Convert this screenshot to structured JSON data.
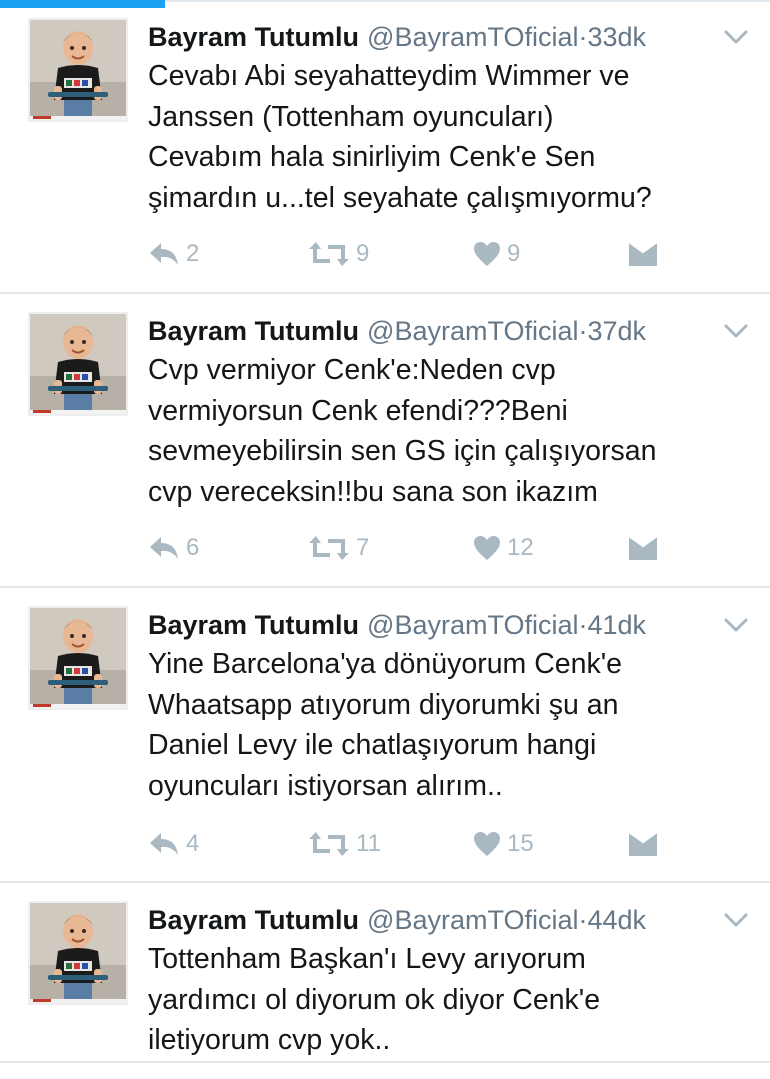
{
  "colors": {
    "accent": "#1da1f2",
    "muted_icon": "#aab8c2",
    "secondary_text": "#657786",
    "divider": "#e1e8ed"
  },
  "tweets": [
    {
      "name": "Bayram Tutumlu",
      "handle": "@BayramTOficial",
      "separator": "·",
      "time": "33dk",
      "lines": [
        "Cevabı Abi seyahatteydim Wimmer ve",
        "Janssen (Tottenham oyuncuları)",
        "Cevabım hala sinirliyim Cenk'e Sen",
        "şimardın u...tel seyahate çalışmıyormu?"
      ],
      "replies": "2",
      "retweets": "9",
      "likes": "9"
    },
    {
      "name": "Bayram Tutumlu",
      "handle": "@BayramTOficial",
      "separator": "·",
      "time": "37dk",
      "lines": [
        "Cvp vermiyor Cenk'e:Neden cvp",
        "vermiyorsun Cenk efendi???Beni",
        "sevmeyebilirsin sen GS için çalışıyorsan",
        "cvp vereceksin!!bu sana son ikazım"
      ],
      "replies": "6",
      "retweets": "7",
      "likes": "12"
    },
    {
      "name": "Bayram Tutumlu",
      "handle": "@BayramTOficial",
      "separator": "·",
      "time": "41dk",
      "lines": [
        "Yine Barcelona'ya dönüyorum Cenk'e",
        "Whaatsapp atıyorum diyorumki şu an",
        "Daniel Levy ile chatlaşıyorum hangi",
        "oyuncuları istiyorsan alırım.."
      ],
      "replies": "4",
      "retweets": "11",
      "likes": "15"
    },
    {
      "name": "Bayram Tutumlu",
      "handle": "@BayramTOficial",
      "separator": "·",
      "time": "44dk",
      "lines": [
        "Tottenham Başkan'ı Levy arıyorum",
        "yardımcı ol diyorum ok diyor Cenk'e",
        "iletiyorum cvp yok.."
      ]
    }
  ]
}
